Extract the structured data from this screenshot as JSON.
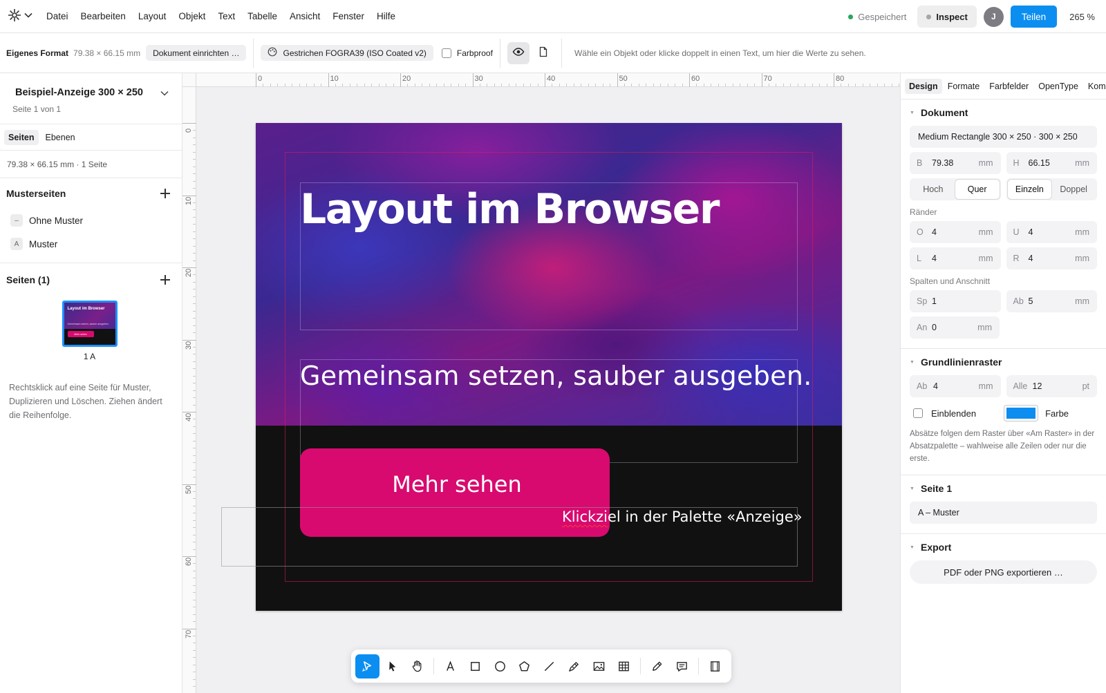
{
  "menubar": {
    "items": [
      "Datei",
      "Bearbeiten",
      "Layout",
      "Objekt",
      "Text",
      "Tabelle",
      "Ansicht",
      "Fenster",
      "Hilfe"
    ],
    "saved_status": "Gespeichert",
    "inspect_label": "Inspect",
    "avatar_initial": "J",
    "share_label": "Teilen",
    "zoom": "265 %"
  },
  "controlbar": {
    "format_name": "Eigenes Format",
    "format_size": "79.38 × 66.15 mm",
    "setup_label": "Dokument einrichten …",
    "profile_label": "Gestrichen FOGRA39 (ISO Coated v2)",
    "proof_label": "Farbproof",
    "hint": "Wähle ein Objekt oder klicke doppelt in einen Text, um hier die Werte zu sehen."
  },
  "left_panel": {
    "doc_title": "Beispiel-Anzeige 300 × 250",
    "doc_pages": "Seite 1 von 1",
    "tabs": [
      "Seiten",
      "Ebenen"
    ],
    "doc_meta": "79.38 × 66.15 mm · 1 Seite",
    "masters_title": "Musterseiten",
    "masters": [
      {
        "badge": "–",
        "label": "Ohne Muster"
      },
      {
        "badge": "A",
        "label": "Muster"
      }
    ],
    "pages_title": "Seiten (1)",
    "thumb": {
      "title": "Layout im Browser",
      "subtitle": "Gemeinsam setzen, sauber ausgeben.",
      "button": "Mehr sehen",
      "label": "1 A"
    },
    "help": "Rechtsklick auf eine Seite für Muster, Duplizieren und Löschen. Ziehen ändert die Reihenfolge."
  },
  "rulers": {
    "h_labels": [
      "0",
      "10",
      "20",
      "30",
      "40",
      "50",
      "60",
      "70",
      "80"
    ],
    "v_labels": [
      "0",
      "10",
      "20",
      "30",
      "40",
      "50",
      "60",
      "70"
    ]
  },
  "artboard": {
    "title": "Layout im Browser",
    "subtitle": "Gemeinsam setzen, sauber ausgeben.",
    "button_label": "Mehr sehen",
    "click_note_a": "Klickzi",
    "click_note_b": "el in der Palette «Anzeige»"
  },
  "toolbar": {
    "tools": [
      "select-tool",
      "direct-select-tool",
      "hand-tool",
      "text-tool",
      "rectangle-tool",
      "ellipse-tool",
      "polygon-tool",
      "line-tool",
      "pen-tool",
      "image-tool",
      "table-tool",
      "pencil-tool",
      "comment-tool",
      "preview-tool"
    ]
  },
  "right_panel": {
    "tabs": [
      "Design",
      "Formate",
      "Farbfelder",
      "OpenType",
      "Kommentare"
    ],
    "document": {
      "title": "Dokument",
      "preset": "Medium Rectangle 300 × 250 · 300 × 250",
      "width_label": "B",
      "width": "79.38",
      "height_label": "H",
      "height": "66.15",
      "unit": "mm",
      "orientation": [
        "Hoch",
        "Quer"
      ],
      "pages_mode": [
        "Einzeln",
        "Doppel"
      ],
      "margins_label": "Ränder",
      "margin_top_label": "O",
      "margin_top": "4",
      "margin_bottom_label": "U",
      "margin_bottom": "4",
      "margin_left_label": "L",
      "margin_left": "4",
      "margin_right_label": "R",
      "margin_right": "4",
      "columns_label": "Spalten und Anschnitt",
      "columns_lbl": "Sp",
      "columns": "1",
      "gutter_lbl": "Ab",
      "gutter": "5",
      "bleed_lbl": "An",
      "bleed": "0"
    },
    "baseline": {
      "title": "Grundlinienraster",
      "start_lbl": "Ab",
      "start": "4",
      "start_unit": "mm",
      "every_lbl": "Alle",
      "every": "12",
      "every_unit": "pt",
      "show_label": "Einblenden",
      "color_label": "Farbe",
      "color": "#0c8ef0",
      "note": "Absätze folgen dem Raster über «Am Raster» in der Absatzpalette – wahlweise alle Zeilen oder nur die erste."
    },
    "page": {
      "title": "Seite 1",
      "master": "A – Muster"
    },
    "export": {
      "title": "Export",
      "button": "PDF oder PNG exportieren …"
    }
  }
}
